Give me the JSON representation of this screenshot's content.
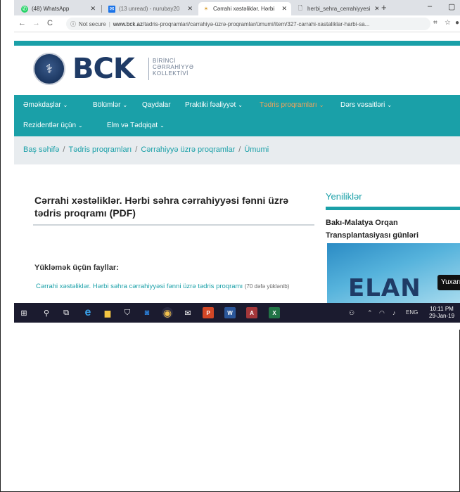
{
  "browser": {
    "tabs": [
      {
        "label": "(48) WhatsApp",
        "icon": "whatsapp-icon",
        "active": false
      },
      {
        "label": "(13 unread) - nurubay20",
        "icon": "mail-icon",
        "active": false
      },
      {
        "label": "Cərrahi xəstəliklər. Hərbi",
        "icon": "site-icon",
        "active": true
      },
      {
        "label": "herbi_sehra_cerrahiyyesi",
        "icon": "document-icon",
        "active": false
      }
    ],
    "new_tab": "+",
    "minimize": "–",
    "maximize": "▢",
    "url_security": "Not secure",
    "url_host": "www.bck.az",
    "url_path": "/tadris-proqramlari/carrahiyə-üzrə-proqramlar/ümumi/item/327-carrahi-xastaliklar-harbi-sa..."
  },
  "site": {
    "logo_text": "BCK",
    "logo_sub": [
      "BİRİNCİ",
      "CƏRRAHİYYƏ",
      "KOLLEKTİVİ"
    ],
    "nav": [
      {
        "label": "Əməkdaşlar",
        "chevron": true,
        "highlight": false
      },
      {
        "label": "Bölümlər",
        "chevron": true,
        "highlight": false
      },
      {
        "label": "Qaydalar",
        "chevron": false,
        "highlight": false
      },
      {
        "label": "Praktiki fəaliyyət",
        "chevron": true,
        "highlight": false
      },
      {
        "label": "Tədris proqramları",
        "chevron": true,
        "highlight": true
      },
      {
        "label": "Dərs vəsaitləri",
        "chevron": true,
        "highlight": false
      },
      {
        "label": "Rezidentlər üçün",
        "chevron": true,
        "highlight": false
      },
      {
        "label": "Elm və Tədqiqat",
        "chevron": true,
        "highlight": false
      }
    ],
    "breadcrumb": [
      "Baş səhifə",
      "Tədris proqramları",
      "Cərrahiyyə üzrə proqramlar",
      "Ümumi"
    ],
    "breadcrumb_sep": "/",
    "article_title": "Cərrahi xəstəliklər. Hərbi səhra cərrahiyyəsi fənni üzrə tədris proqramı (PDF)",
    "files_heading": "Yükləmək üçün fayllar:",
    "file_link": "Cərrahi xəstəliklər. Hərbi səhra cərrahiyyəsi fənni üzrə tədris proqramı",
    "file_downloads": "(70 dəfə yüklənib)",
    "sidebar_heading": "Yeniliklər",
    "sidebar_news_title": "Bakı-Malatya Orqan Transplantasiyası günləri",
    "sidebar_image_text": "ELAN",
    "scroll_top": "Yuxarı"
  },
  "taskbar": {
    "language": "ENG",
    "time": "10:11 PM",
    "date": "29-Jan-19"
  },
  "colors": {
    "teal": "#1aa0a8",
    "nav_highlight": "#f2a35a",
    "logo_navy": "#1f3b66",
    "breadcrumb_bg": "#e8ecef"
  }
}
